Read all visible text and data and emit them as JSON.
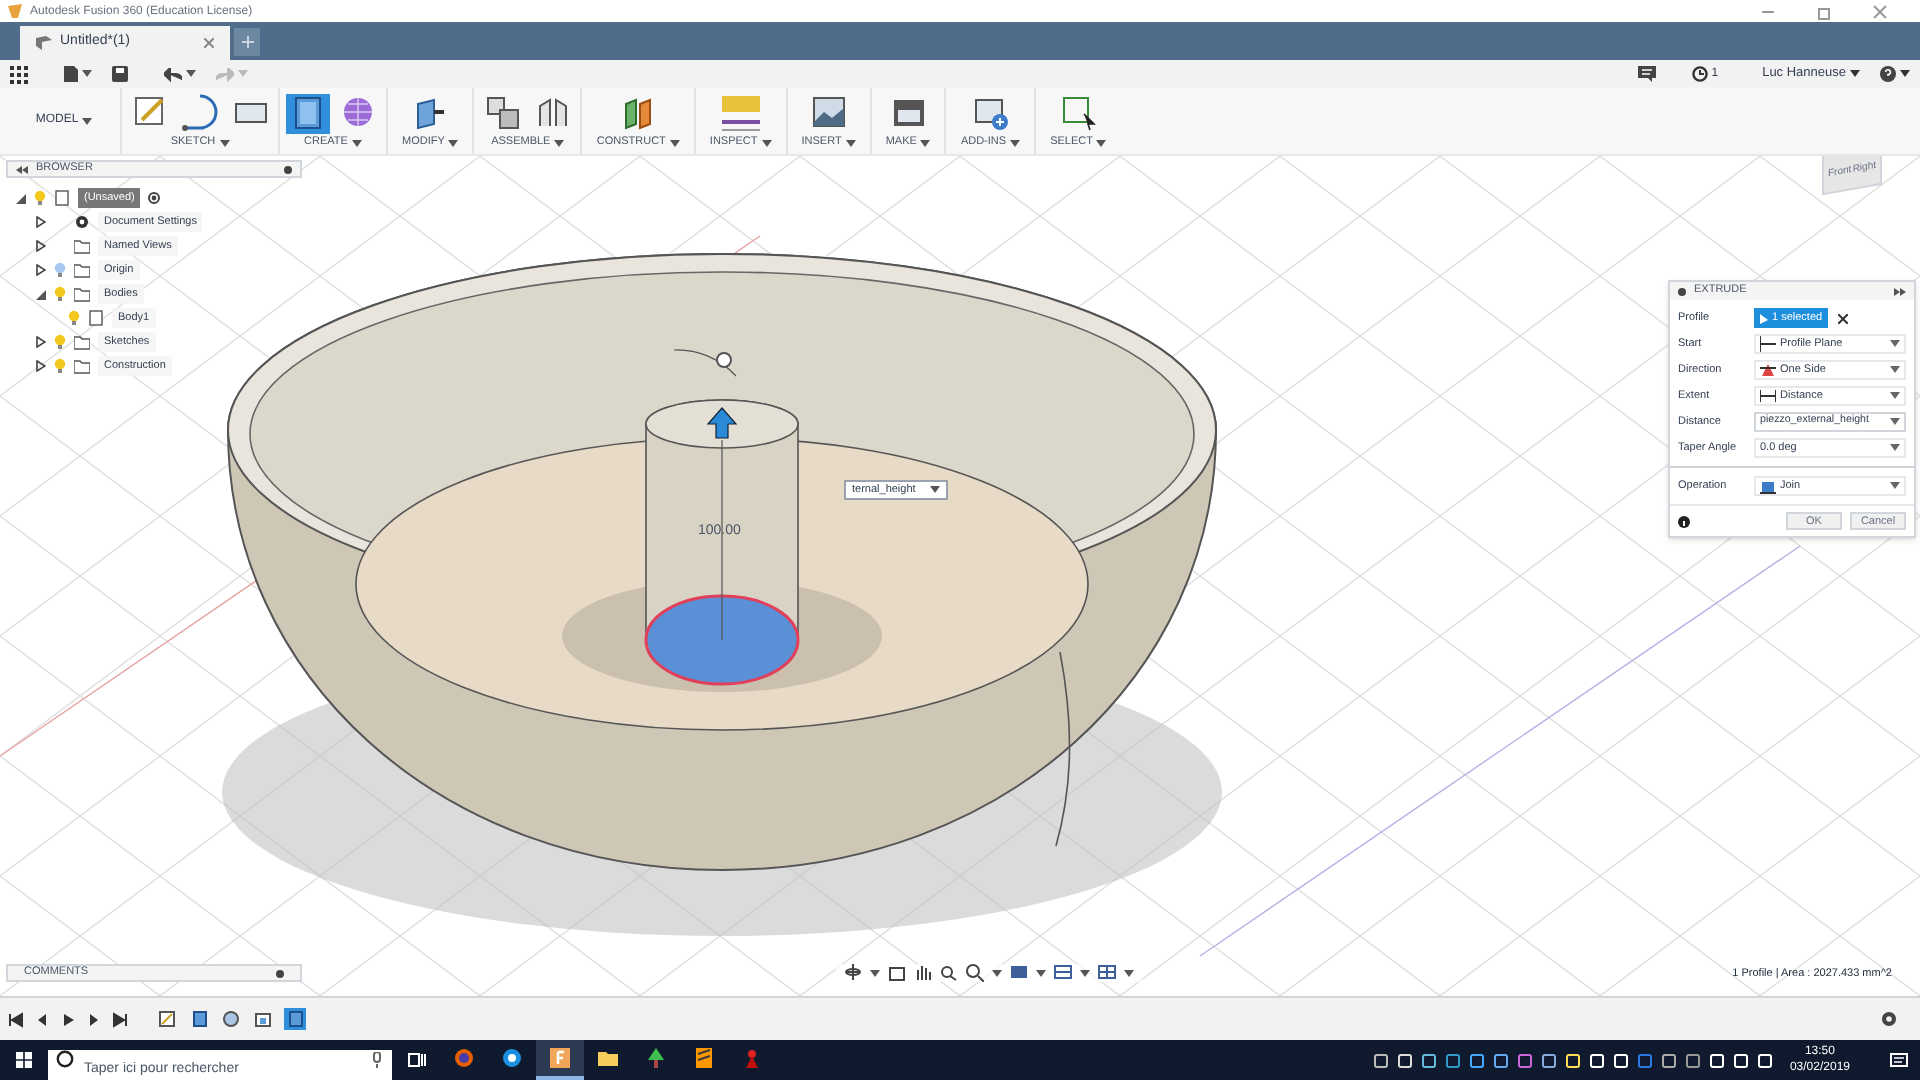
{
  "window": {
    "title": "Autodesk Fusion 360 (Education License)"
  },
  "document_tabs": [
    {
      "label": "Untitled*(1)",
      "selected": true
    }
  ],
  "header_right": {
    "job_count": "1",
    "user": "Luc Hanneuse"
  },
  "workspace": "MODEL",
  "toolbar_groups": [
    {
      "label": "SKETCH",
      "tools": [
        {
          "kind": "sketch",
          "active": false
        },
        {
          "kind": "line",
          "active": false
        },
        {
          "kind": "rectangle",
          "active": false
        }
      ]
    },
    {
      "label": "CREATE",
      "tools": [
        {
          "kind": "extrude",
          "active": true
        },
        {
          "kind": "form",
          "active": false
        }
      ]
    },
    {
      "label": "MODIFY",
      "tools": [
        {
          "kind": "press-pull",
          "active": false
        }
      ]
    },
    {
      "label": "ASSEMBLE",
      "tools": [
        {
          "kind": "component",
          "active": false
        },
        {
          "kind": "joint",
          "active": false
        }
      ]
    },
    {
      "label": "CONSTRUCT",
      "tools": [
        {
          "kind": "plane",
          "active": false
        }
      ]
    },
    {
      "label": "INSPECT",
      "tools": [
        {
          "kind": "measure",
          "active": false
        }
      ]
    },
    {
      "label": "INSERT",
      "tools": [
        {
          "kind": "image",
          "active": false
        }
      ]
    },
    {
      "label": "MAKE",
      "tools": [
        {
          "kind": "print",
          "active": false
        }
      ]
    },
    {
      "label": "ADD-INS",
      "tools": [
        {
          "kind": "addin",
          "active": false
        }
      ]
    },
    {
      "label": "SELECT",
      "tools": [
        {
          "kind": "select",
          "active": false
        }
      ]
    }
  ],
  "browser": {
    "title": "BROWSER",
    "tree": [
      {
        "label": "(Unsaved)",
        "kind": "component",
        "expanded": true,
        "visible": true,
        "selected": true,
        "children": [
          {
            "label": "Document Settings",
            "kind": "settings",
            "expanded": false,
            "selected": false
          },
          {
            "label": "Named Views",
            "kind": "folder",
            "expanded": false,
            "selected": false
          },
          {
            "label": "Origin",
            "kind": "folder",
            "expanded": false,
            "visible": false,
            "selected": false
          },
          {
            "label": "Bodies",
            "kind": "folder",
            "expanded": true,
            "visible": true,
            "selected": false,
            "children": [
              {
                "label": "Body1",
                "kind": "body",
                "visible": true,
                "selected": false
              }
            ]
          },
          {
            "label": "Sketches",
            "kind": "folder",
            "expanded": false,
            "visible": true,
            "selected": false
          },
          {
            "label": "Construction",
            "kind": "folder",
            "expanded": false,
            "visible": true,
            "selected": false
          }
        ]
      }
    ]
  },
  "viewcube": {
    "faces": [
      "Front",
      "Right"
    ]
  },
  "viewport": {
    "dimension": "100.00",
    "distance_input": "ternal_height"
  },
  "extrude_dialog": {
    "title": "EXTRUDE",
    "sections": [
      [
        {
          "label": "Profile",
          "kind": "selection",
          "value": "1 selected"
        },
        {
          "label": "Start",
          "kind": "dropdown",
          "value": "Profile Plane"
        },
        {
          "label": "Direction",
          "kind": "dropdown",
          "value": "One Side"
        },
        {
          "label": "Extent",
          "kind": "dropdown",
          "value": "Distance"
        },
        {
          "label": "Distance",
          "kind": "input",
          "value": "piezzo_external_height"
        },
        {
          "label": "Taper Angle",
          "kind": "spinner",
          "value": "0.0 deg"
        }
      ],
      [
        {
          "label": "Operation",
          "kind": "dropdown",
          "value": "Join"
        }
      ]
    ],
    "buttons": [
      "OK",
      "Cancel"
    ]
  },
  "comments": {
    "title": "COMMENTS"
  },
  "status": "1 Profile | Area : 2027.433 mm^2",
  "timeline": [
    {
      "kind": "sketch",
      "selected": false
    },
    {
      "kind": "extrude",
      "selected": false
    },
    {
      "kind": "revolve",
      "selected": false
    },
    {
      "kind": "shell",
      "selected": false
    },
    {
      "kind": "extrude",
      "selected": true
    }
  ],
  "taskbar": {
    "search_placeholder": "Taper ici pour rechercher",
    "apps": [
      {
        "kind": "firefox",
        "selected": false
      },
      {
        "kind": "browser",
        "selected": false
      },
      {
        "kind": "fusion",
        "selected": true
      },
      {
        "kind": "explorer",
        "selected": false
      },
      {
        "kind": "tree",
        "selected": false
      },
      {
        "kind": "sublime",
        "selected": false
      },
      {
        "kind": "red",
        "selected": false
      }
    ],
    "time": "13:50",
    "date": "03/02/2019"
  }
}
